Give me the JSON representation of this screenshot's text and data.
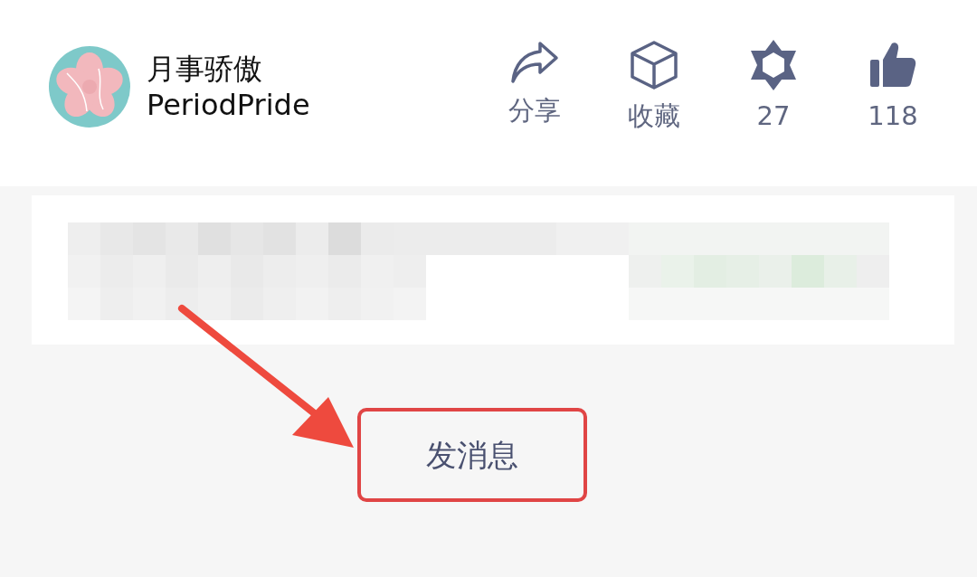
{
  "profile": {
    "name": "月事骄傲",
    "handle": "PeriodPride"
  },
  "actions": [
    {
      "kind": "share",
      "label": "分享"
    },
    {
      "kind": "collect",
      "label": "收藏"
    },
    {
      "kind": "star",
      "label": "27"
    },
    {
      "kind": "like",
      "label": "118"
    }
  ],
  "message_button": {
    "label": "发消息"
  }
}
